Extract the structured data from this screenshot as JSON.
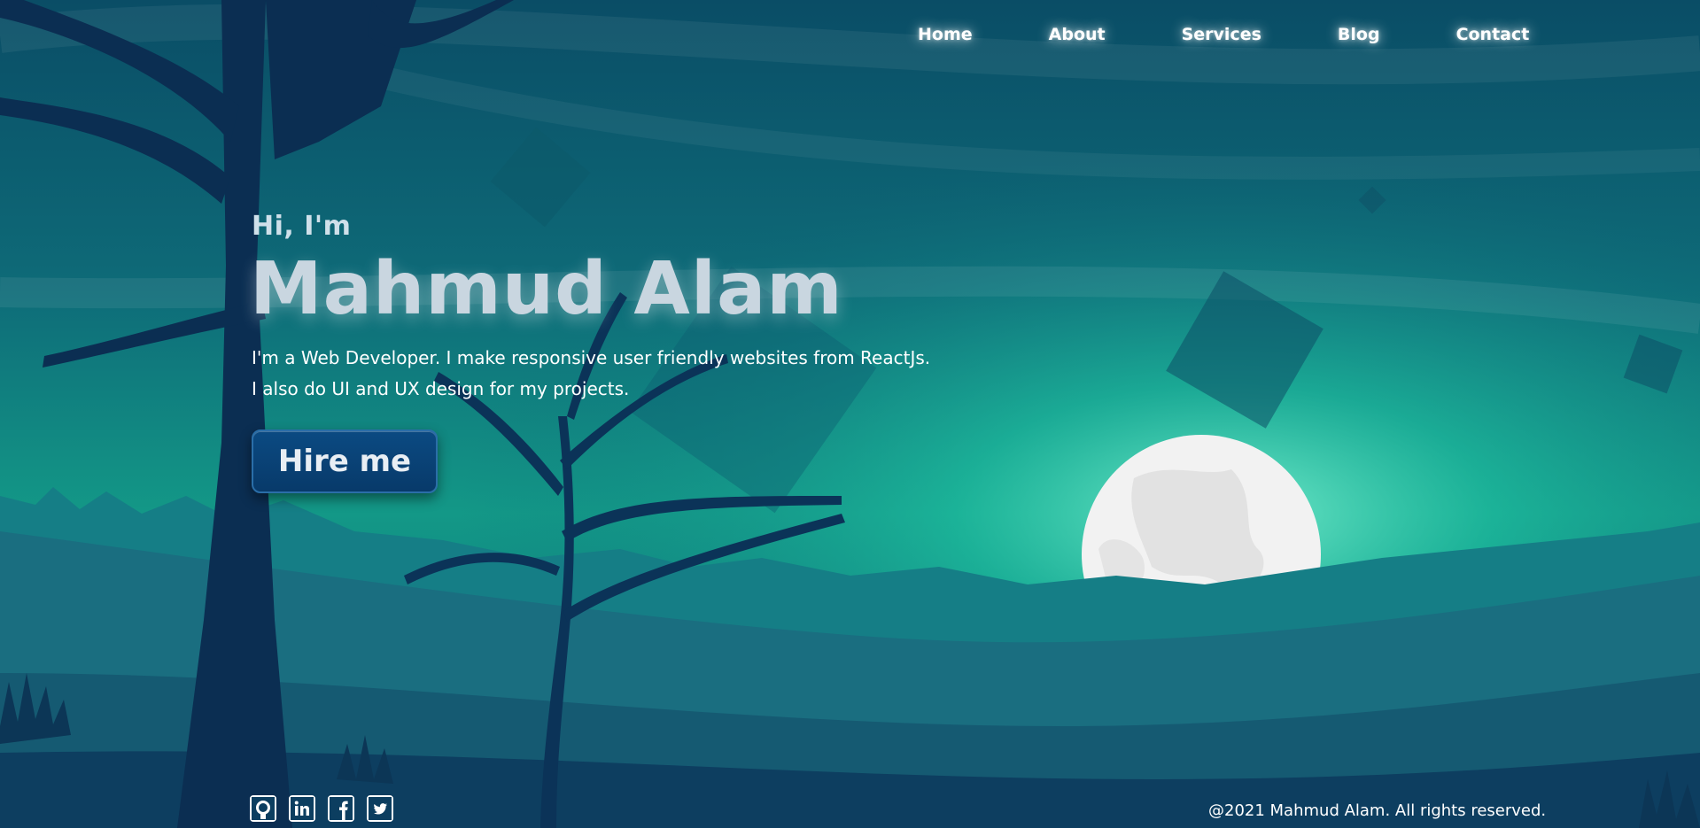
{
  "nav": {
    "items": [
      {
        "label": "Home"
      },
      {
        "label": "About"
      },
      {
        "label": "Services"
      },
      {
        "label": "Blog"
      },
      {
        "label": "Contact"
      }
    ]
  },
  "hero": {
    "greeting": "Hi, I'm",
    "name": "Mahmud Alam",
    "bio_line1": "I'm a Web Developer. I make responsive user friendly websites from ReactJs.",
    "bio_line2": "I also do UI and UX design for my projects.",
    "cta_label": "Hire me"
  },
  "socials": [
    {
      "icon": "github-icon"
    },
    {
      "icon": "linkedin-icon"
    },
    {
      "icon": "facebook-icon"
    },
    {
      "icon": "twitter-icon"
    }
  ],
  "footer": {
    "copyright": "@2021 Mahmud Alam. All rights reserved."
  },
  "colors": {
    "sky_top": "#0a4d66",
    "sky_glow": "#1ec8a0",
    "moon": "#f2f2f2",
    "tree": "#0b2e52",
    "button_bg": "#083e74"
  }
}
